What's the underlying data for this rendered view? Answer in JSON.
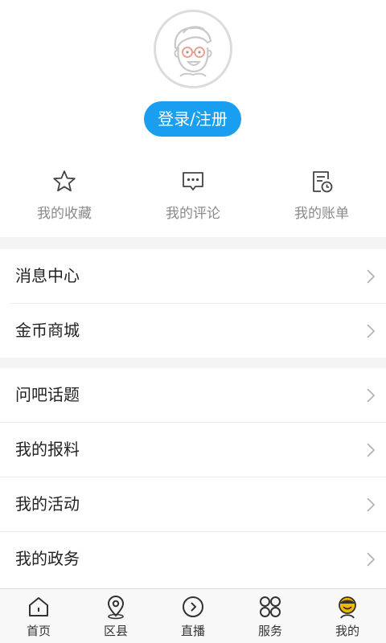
{
  "profile": {
    "login_label": "登录/注册"
  },
  "quick_actions": [
    {
      "label": "我的收藏",
      "icon": "star-icon"
    },
    {
      "label": "我的评论",
      "icon": "comment-icon"
    },
    {
      "label": "我的账单",
      "icon": "bill-icon"
    }
  ],
  "menu_group_1": [
    {
      "label": "消息中心"
    },
    {
      "label": "金币商城"
    }
  ],
  "menu_group_2": [
    {
      "label": "问吧话题"
    },
    {
      "label": "我的报料"
    },
    {
      "label": "我的活动"
    },
    {
      "label": "我的政务"
    }
  ],
  "tabs": [
    {
      "label": "首页",
      "icon": "home-icon"
    },
    {
      "label": "区县",
      "icon": "location-pin-icon"
    },
    {
      "label": "直播",
      "icon": "play-circle-icon"
    },
    {
      "label": "服务",
      "icon": "grid-circles-icon"
    },
    {
      "label": "我的",
      "icon": "user-face-icon",
      "active": true
    }
  ],
  "colors": {
    "accent": "#1a9ff0",
    "active_tab": "#f5b800",
    "divider": "#f4f4f4"
  }
}
